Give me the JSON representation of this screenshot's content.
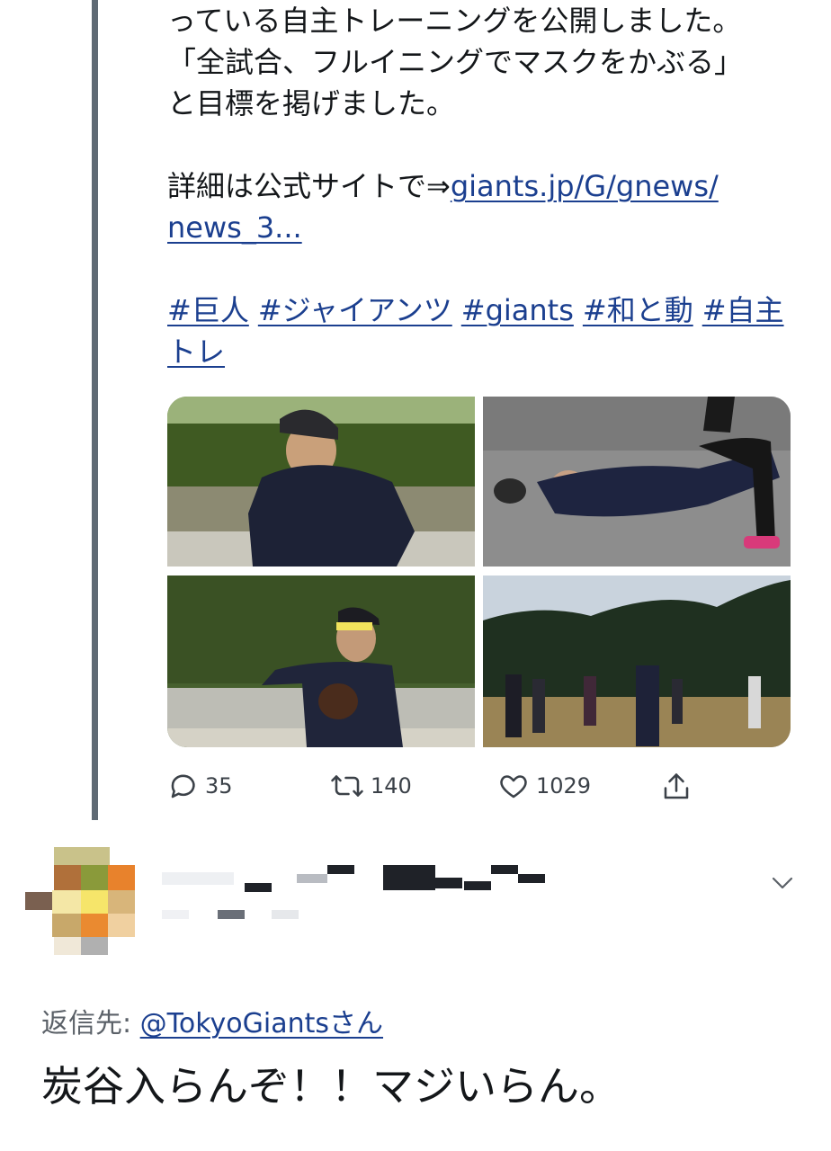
{
  "tweet": {
    "lines": [
      "っている自主トレーニングを公開しました。",
      "「全試合、フルイニングでマスクをかぶる」",
      "と目標を掲げました。"
    ],
    "detail_prefix": "詳細は公式サイトで⇒",
    "detail_link_part1": "giants.jp/G/gnews/",
    "detail_link_part2": "news_3...",
    "hashtags": [
      "#巨人",
      "#ジャイアンツ",
      "#giants",
      "#和と動",
      "#自主"
    ],
    "hashtag_continued": "トレ",
    "media_alts": [
      "player-running-photo",
      "player-lying-on-ground-photo",
      "player-throwing-photo",
      "team-practice-field-photo"
    ]
  },
  "actions": {
    "replies": "35",
    "retweets": "140",
    "likes": "1029",
    "icons": [
      "speech-bubble-icon",
      "retweet-icon",
      "heart-icon",
      "share-icon"
    ]
  },
  "reply": {
    "reply_to_label": "返信先:",
    "reply_to_handle": "@TokyoGiantsさん",
    "text": "炭谷入らんぞ！！マジいらん。"
  },
  "colors": {
    "link": "#1b3f8f",
    "thread_line": "#5f6a74",
    "text": "#14171a",
    "muted": "#5b6168"
  }
}
